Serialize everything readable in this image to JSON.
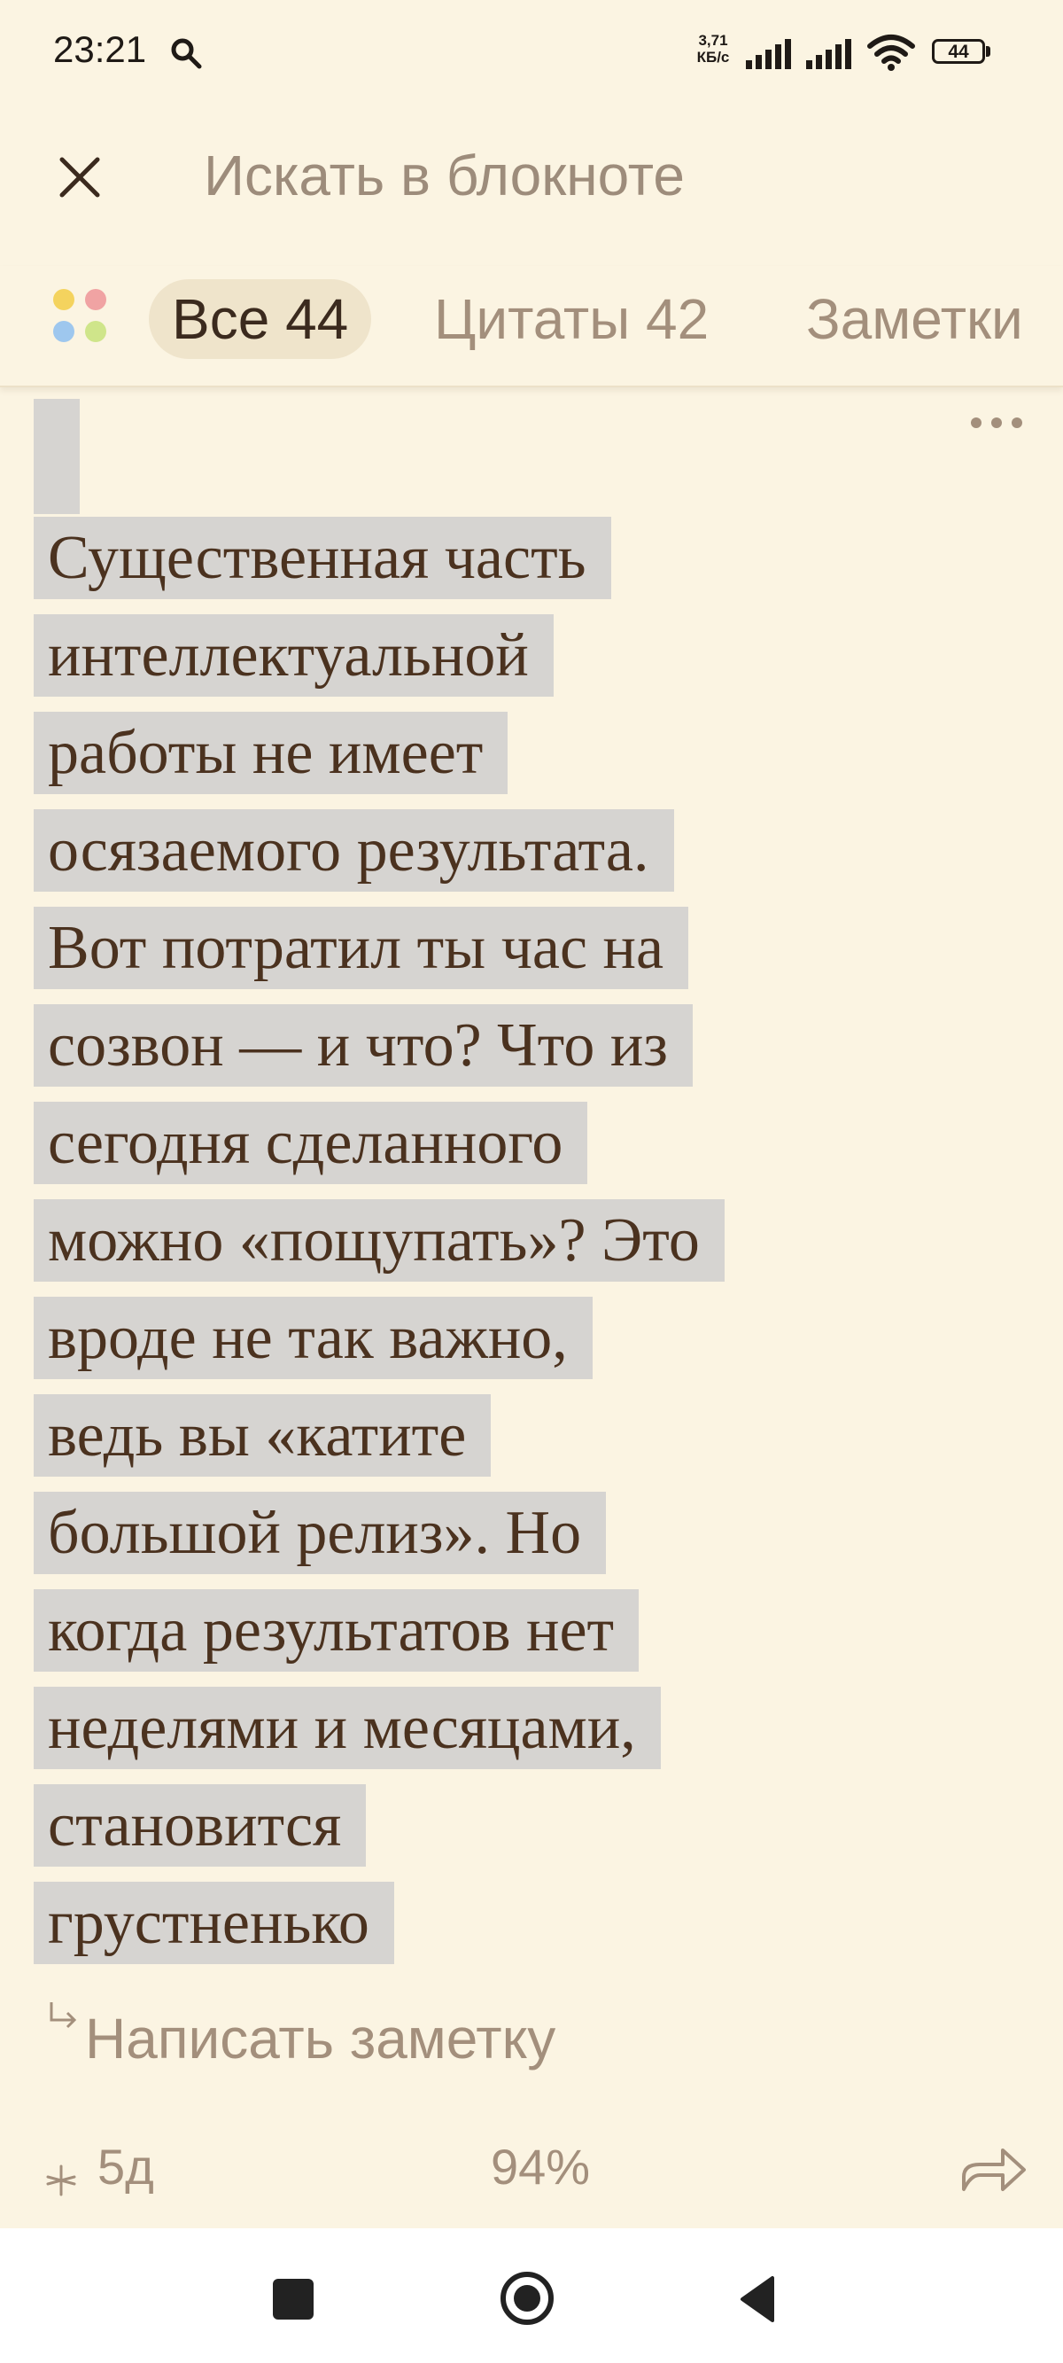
{
  "status_bar": {
    "time": "23:21",
    "net_speed_value": "3,71",
    "net_speed_unit": "КБ/с",
    "battery_level": "44"
  },
  "search": {
    "placeholder": "Искать в блокноте"
  },
  "filter_tabs": [
    {
      "label": "Все 44",
      "active": true
    },
    {
      "label": "Цитаты 42",
      "active": false
    },
    {
      "label": "Заметки",
      "active": false
    }
  ],
  "quote": {
    "lines": [
      "Существенная часть",
      "интеллектуальной",
      "работы не имеет",
      "осязаемого результата.",
      "Вот потратил ты час на",
      "созвон — и что? Что из",
      "сегодня сделанного",
      "можно «пощупать»? Это",
      "вроде не так важно,",
      "ведь вы «катите",
      "большой релиз». Но",
      "когда результатов нет",
      "неделями и месяцами,",
      "становится",
      "грустненько"
    ],
    "highlight_color": "#d6d4d1"
  },
  "note_link": {
    "label": "Написать заметку"
  },
  "footer": {
    "age": "5д",
    "progress": "94%"
  },
  "colors": {
    "background": "#fbf4e2",
    "text_primary": "#3b2a1e",
    "text_secondary": "#a38f7c",
    "active_tab_bg": "#efe4cb",
    "dot_yellow": "#f4d35e",
    "dot_pink": "#f0a3a3",
    "dot_blue": "#9ec7ee",
    "dot_green": "#cfe58a"
  },
  "icons": {
    "status_search": "search-icon",
    "close": "close-icon",
    "tab_filter": "color-dots-icon",
    "more": "more-horizontal-icon",
    "note": "reply-arrow-icon",
    "star": "star-icon",
    "share": "share-icon",
    "nav_recents": "recents-icon",
    "nav_home": "home-icon",
    "nav_back": "back-icon"
  }
}
